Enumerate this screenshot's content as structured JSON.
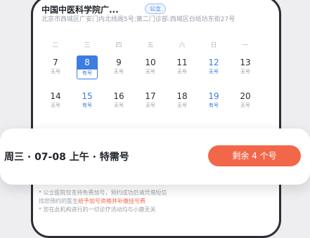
{
  "hospital": {
    "name": "中国中医科学院广...",
    "badge": "公立",
    "address": "北京市西城区广安门内北线阁5号;第二门诊部:西城区白纸坊东街27号"
  },
  "calendar": {
    "weekdays": [
      "二",
      "三",
      "四",
      "五",
      "六",
      "日",
      "一"
    ],
    "days": [
      {
        "num": "7",
        "status": "无号"
      },
      {
        "num": "8",
        "status": "有号",
        "selected": true
      },
      {
        "num": "9",
        "status": "无号"
      },
      {
        "num": "10",
        "status": "无号"
      },
      {
        "num": "11",
        "status": "无号"
      },
      {
        "num": "12",
        "status": "无号"
      },
      {
        "num": "13",
        "status": "无号"
      },
      {
        "num": "14",
        "status": "无号"
      },
      {
        "num": "15",
        "status": "有号"
      },
      {
        "num": "16",
        "status": "无号"
      },
      {
        "num": "17",
        "status": "无号"
      },
      {
        "num": "18",
        "status": "无号"
      },
      {
        "num": "19",
        "status": "有号"
      },
      {
        "num": "20",
        "status": "无号"
      }
    ]
  },
  "slot": {
    "text": "周三 · 07-08 上午 · 特需号",
    "remain_label": "剩余 4 个号"
  },
  "notes": {
    "line1": "* 公立医院仅支持免费加号，预约成功后请凭借短信",
    "line2_pre": "找您预约的医生",
    "line2_hl": "给予加号资格并补缴挂号费",
    "line3": "* 您在此机构进行的一切诊疗活动均与小鹿无关"
  },
  "colors": {
    "accent_blue": "#3b7de0",
    "accent_orange": "#f2674a"
  }
}
